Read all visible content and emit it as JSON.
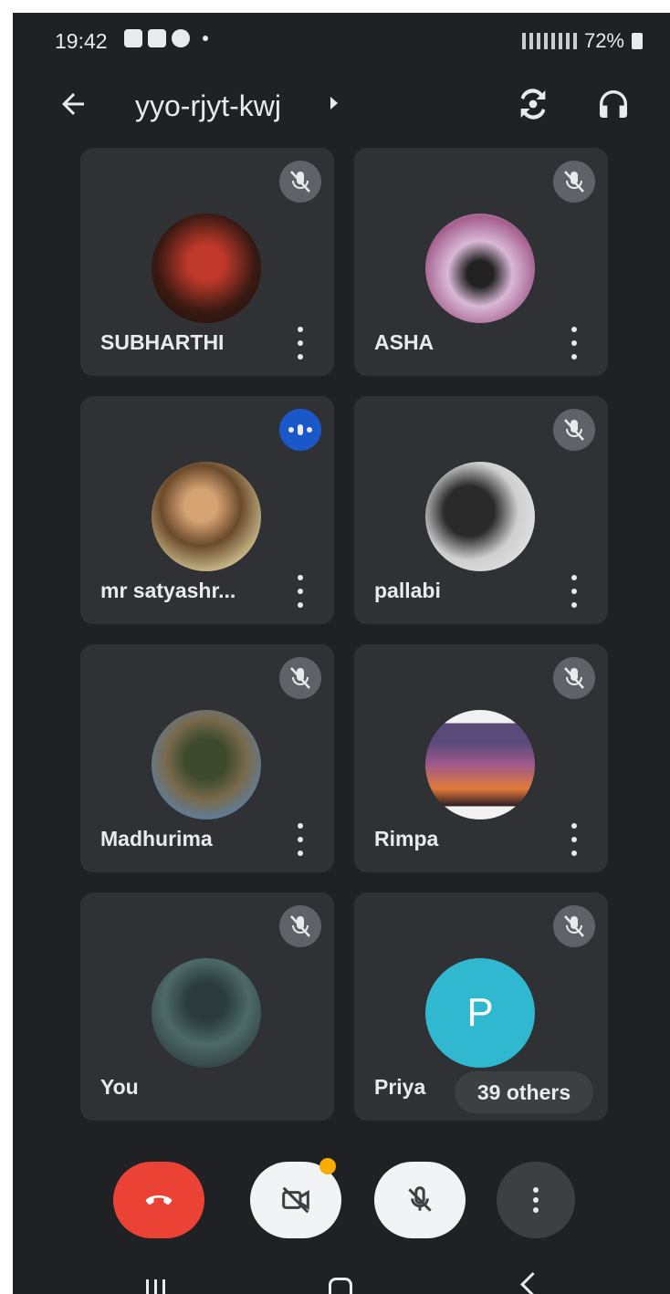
{
  "status_bar": {
    "time": "19:42",
    "battery": "72%"
  },
  "app_bar": {
    "meeting_code": "yyo-rjyt-kwj"
  },
  "participants": [
    {
      "name": "SUBHARTHI",
      "state": "muted"
    },
    {
      "name": "ASHA",
      "state": "muted"
    },
    {
      "name": "mr satyashr...",
      "state": "speaking"
    },
    {
      "name": "pallabi",
      "state": "muted"
    },
    {
      "name": "Madhurima",
      "state": "muted"
    },
    {
      "name": "Rimpa",
      "state": "muted"
    },
    {
      "name": "You",
      "state": "muted"
    },
    {
      "name": "Priya",
      "state": "muted",
      "initial": "P"
    }
  ],
  "others_chip": "39 others",
  "controls": [
    "end-call",
    "camera-off",
    "mic-off",
    "more-options"
  ],
  "colors": {
    "background": "#202124",
    "tile": "#303134",
    "end_call": "#ea4335",
    "speaking": "#1a57c9",
    "priya_avatar": "#2fb8cf"
  }
}
